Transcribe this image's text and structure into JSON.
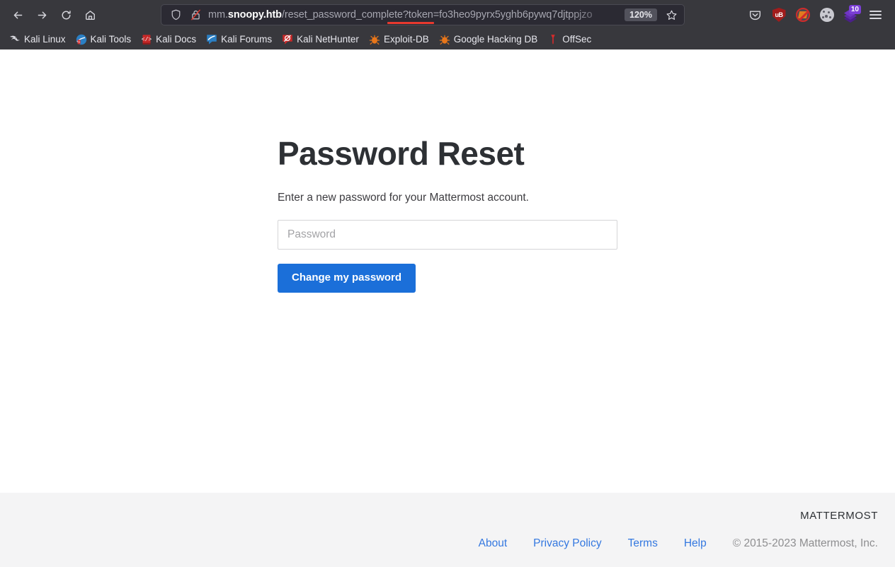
{
  "browser": {
    "nav": {
      "back_label": "Back",
      "forward_label": "Forward",
      "reload_label": "Reload",
      "home_label": "Home"
    },
    "urlbar": {
      "shield_label": "Enhanced Tracking Protection",
      "lock_label": "Connection is not secure",
      "url_prefix": "mm.",
      "url_host": "snoopy.htb",
      "url_path": "/reset_password_complete?token=fo3heo9pyrx5yghb6pywq7djtppjzo",
      "full_url": "mm.snoopy.htb/reset_password_complete?token=fo3heo9pyrx5yghb6pywq7djtppjzo",
      "zoom_level": "120%",
      "bookmark_label": "Bookmark this page"
    },
    "toolbar_right": [
      {
        "name": "pocket-icon",
        "label": "Save to Pocket"
      },
      {
        "name": "ublock-origin-icon",
        "label": "uB"
      },
      {
        "name": "noscript-icon",
        "label": "NoScript"
      },
      {
        "name": "cookie-manager-icon",
        "label": "Cookie Manager"
      },
      {
        "name": "downloads-icon",
        "label": "Downloads",
        "badge": "10"
      },
      {
        "name": "application-menu-icon",
        "label": "Open application menu"
      }
    ],
    "bookmarks": [
      {
        "label": "Kali Linux",
        "icon": "kali-dragon-icon"
      },
      {
        "label": "Kali Tools",
        "icon": "kali-tools-icon"
      },
      {
        "label": "Kali Docs",
        "icon": "kali-docs-icon"
      },
      {
        "label": "Kali Forums",
        "icon": "kali-forums-icon"
      },
      {
        "label": "Kali NetHunter",
        "icon": "kali-nethunter-icon"
      },
      {
        "label": "Exploit-DB",
        "icon": "exploit-db-icon"
      },
      {
        "label": "Google Hacking DB",
        "icon": "google-hacking-db-icon"
      },
      {
        "label": "OffSec",
        "icon": "offsec-icon"
      }
    ]
  },
  "page": {
    "title": "Password Reset",
    "subtitle": "Enter a new password for your Mattermost account.",
    "password_placeholder": "Password",
    "password_value": "",
    "submit_label": "Change my password"
  },
  "footer": {
    "logo": "MATTERMOST",
    "links": [
      {
        "label": "About"
      },
      {
        "label": "Privacy Policy"
      },
      {
        "label": "Terms"
      },
      {
        "label": "Help"
      }
    ],
    "copyright": "© 2015-2023 Mattermost, Inc."
  },
  "colors": {
    "chrome_bg": "#38383d",
    "urlbar_bg": "#2b2a33",
    "accent_blue": "#1b6fd9",
    "link_blue": "#3478e0",
    "footer_bg": "#f4f4f5",
    "underline_red": "#e8392e"
  }
}
